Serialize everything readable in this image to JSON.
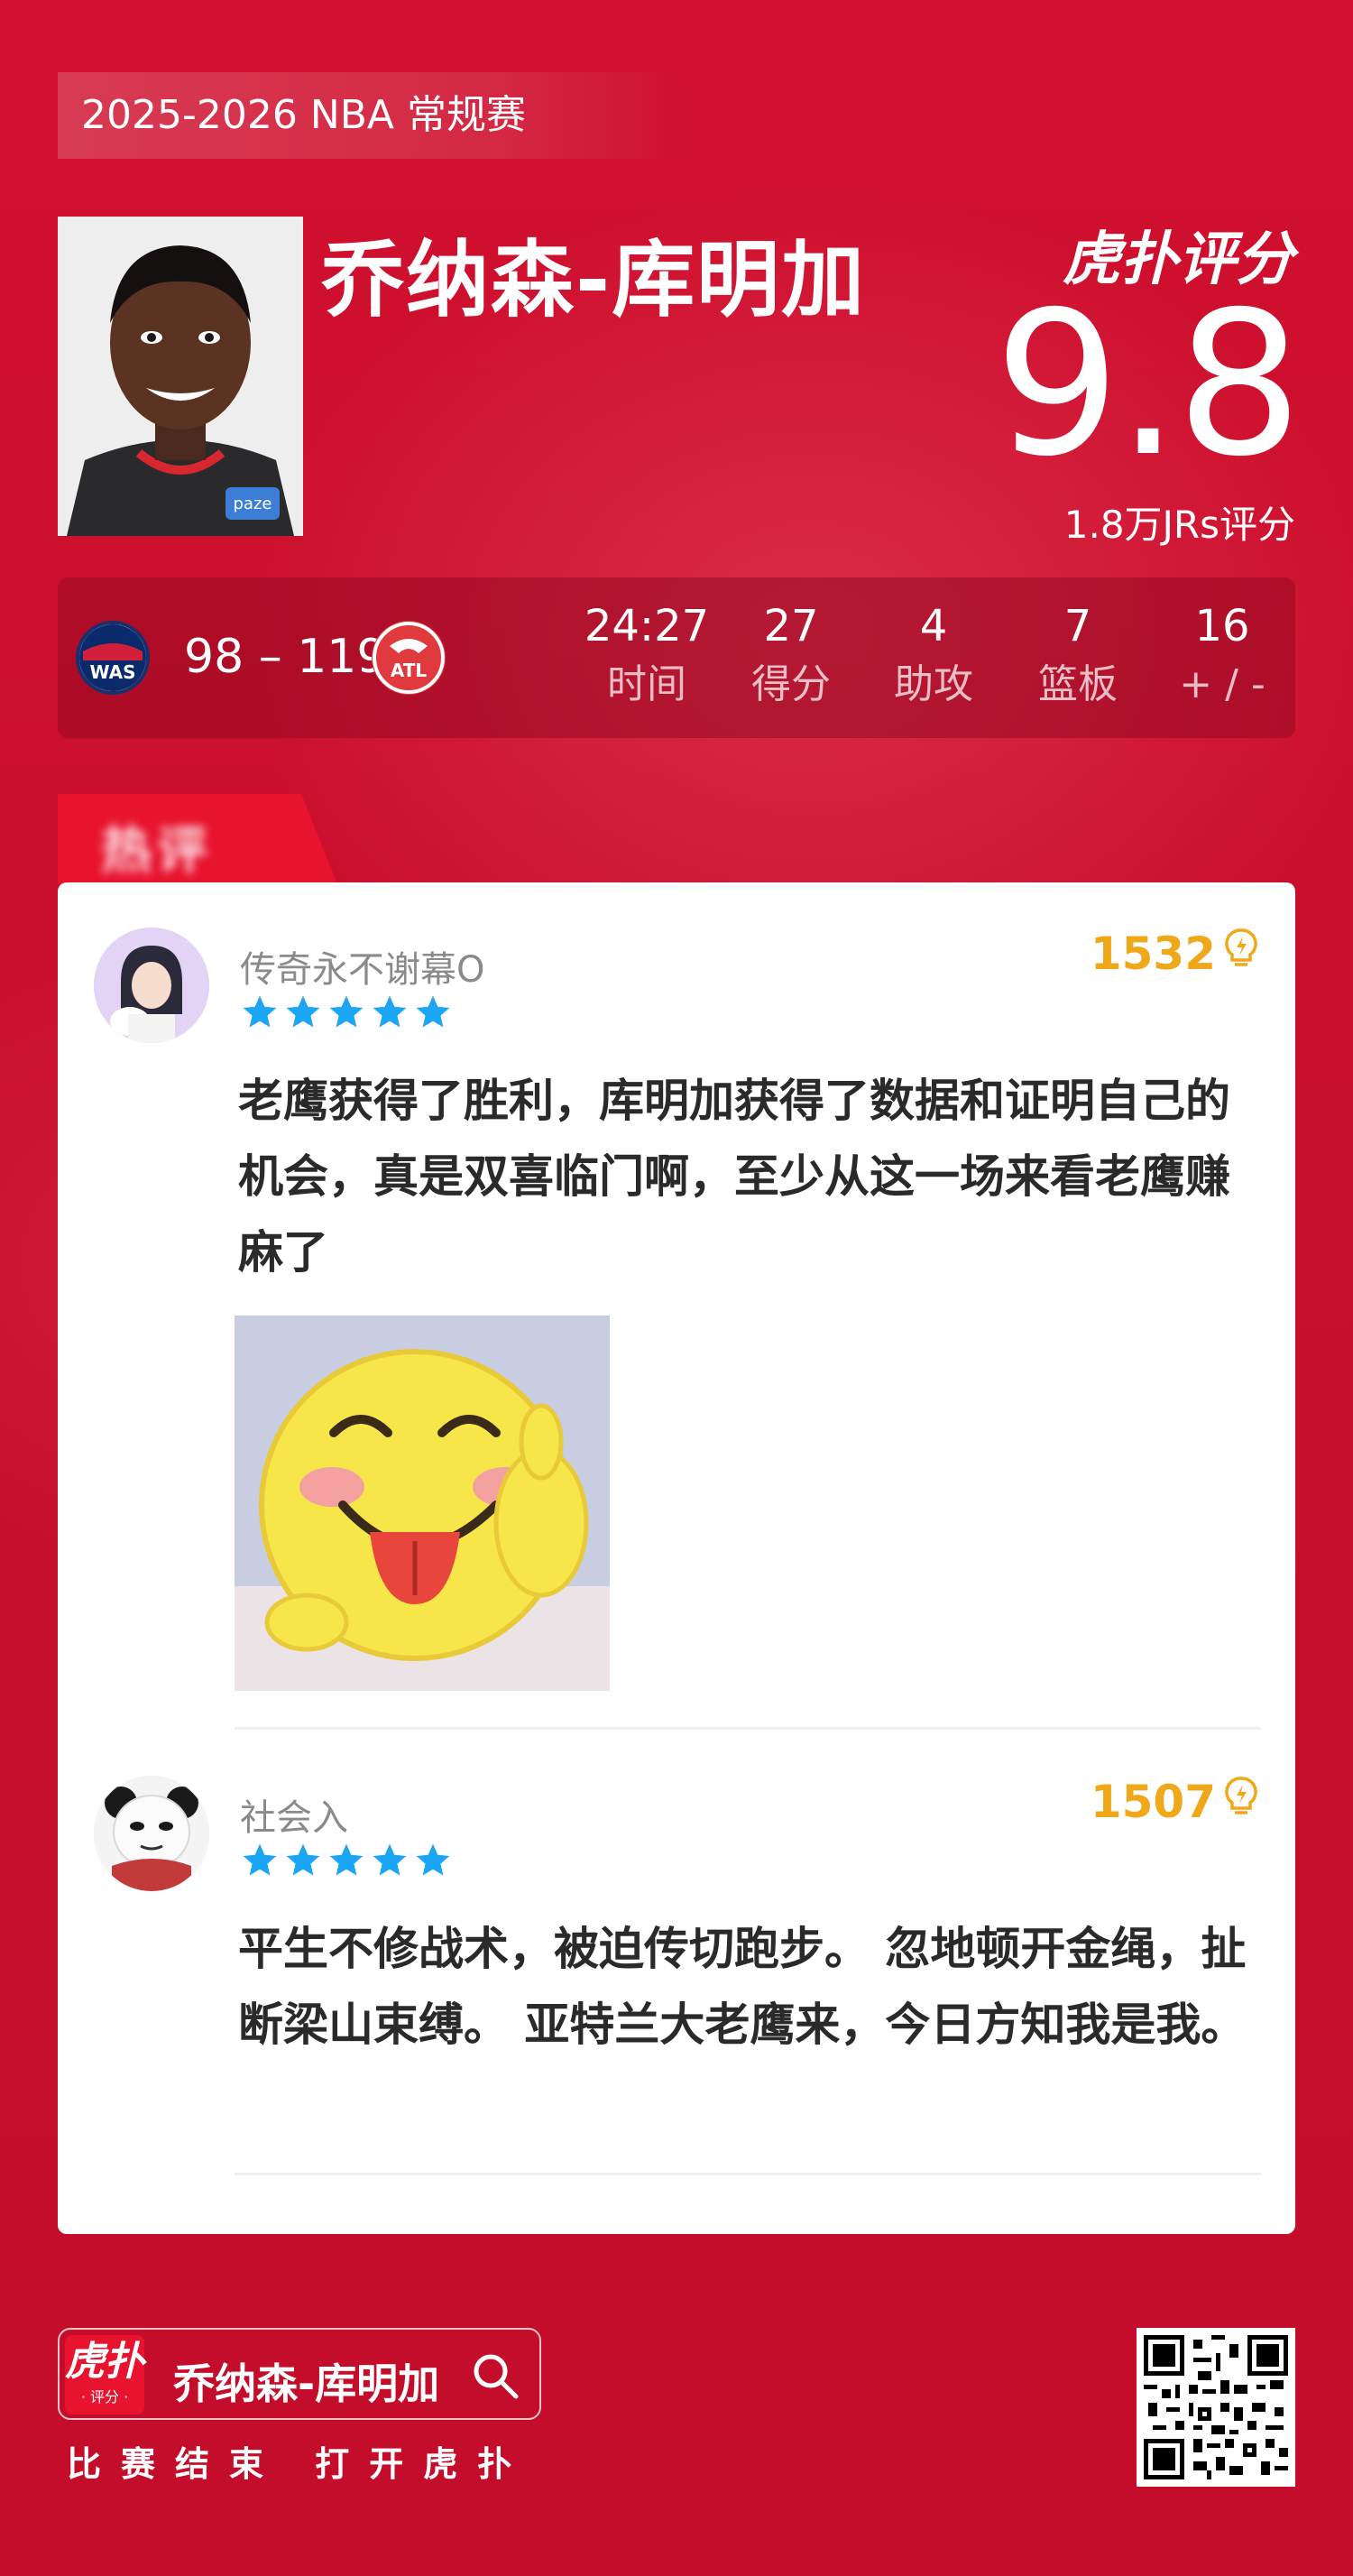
{
  "header": {
    "season": "2025-2026 NBA 常规赛",
    "player_name": "乔纳森-库明加",
    "brand": "虎扑评分",
    "rating": "9.8",
    "raters": "1.8万JRs评分"
  },
  "game": {
    "home_team": "WAS",
    "score": "98 – 119",
    "away_team": "ATL",
    "stats": [
      {
        "value": "24:27",
        "label": "时间"
      },
      {
        "value": "27",
        "label": "得分"
      },
      {
        "value": "4",
        "label": "助攻"
      },
      {
        "value": "7",
        "label": "篮板"
      },
      {
        "value": "16",
        "label": "+ / -"
      }
    ]
  },
  "hot_tab_label": "热评",
  "comments": [
    {
      "username": "传奇永不谢幕O",
      "stars": 5,
      "likes": "1532",
      "text": "老鹰获得了胜利，库明加获得了数据和证明自己的机会，真是双喜临门啊，至少从这一场来看老鹰赚麻了"
    },
    {
      "username": "社会入",
      "stars": 5,
      "likes": "1507",
      "text": "平生不修战术，被迫传切跑步。 忽地顿开金绳，扯断梁山束缚。 亚特兰大老鹰来，今日方知我是我。"
    }
  ],
  "footer": {
    "logo_text": "虎扑",
    "logo_sub": "· 评分 ·",
    "search_name": "乔纳森-库明加",
    "tagline": "比赛结束 打开虎扑"
  },
  "colors": {
    "background": "#c8102e",
    "star": "#1aa6f2",
    "likes": "#f0a81b"
  }
}
